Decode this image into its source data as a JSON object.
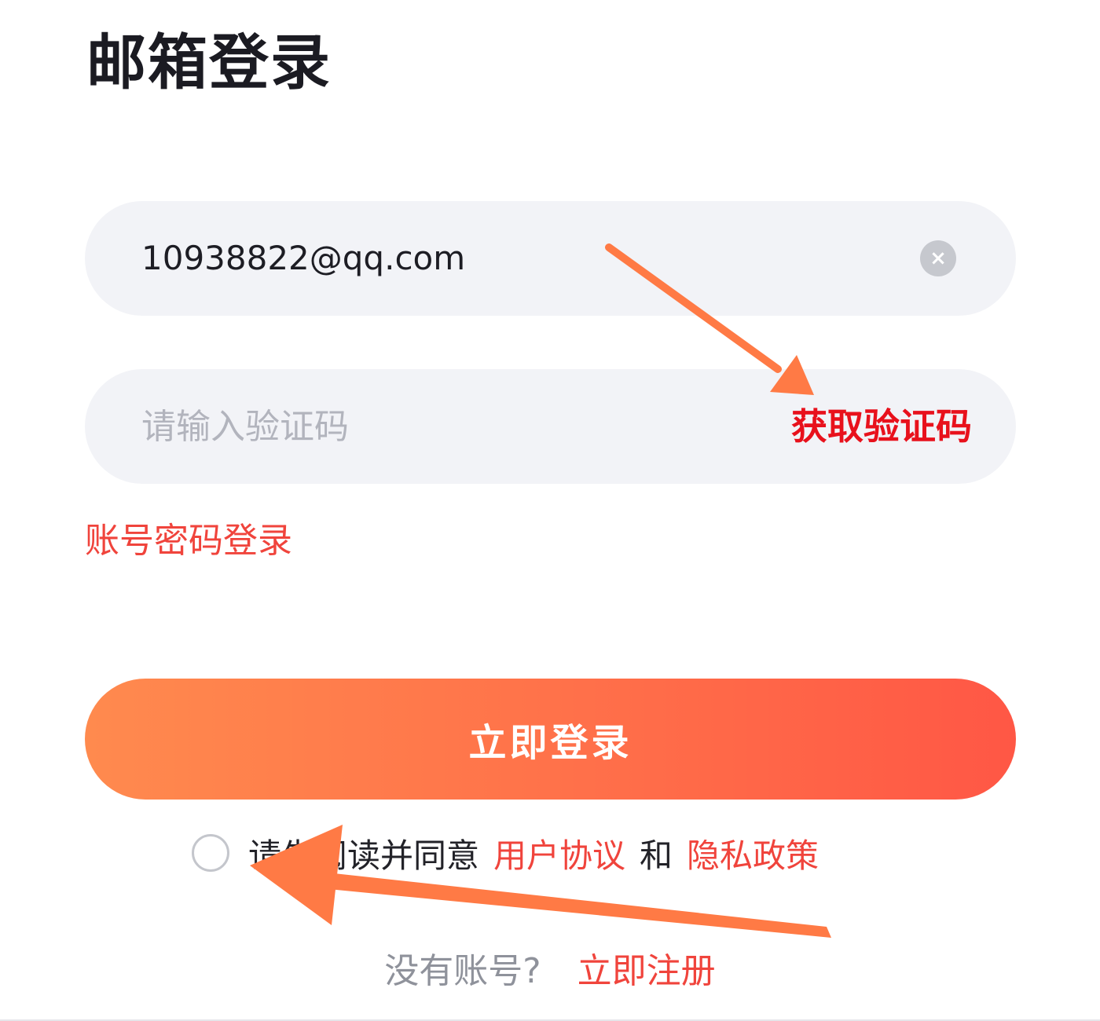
{
  "page": {
    "title": "邮箱登录"
  },
  "email_field": {
    "value": "10938822@qq.com",
    "clear_icon": "close-circle-icon",
    "clear_glyph": "×"
  },
  "code_field": {
    "placeholder": "请输入验证码",
    "value": "",
    "get_code_label": "获取验证码"
  },
  "switch_login": {
    "label": "账号密码登录"
  },
  "login_button": {
    "label": "立即登录"
  },
  "agreement": {
    "checked": false,
    "prefix": "请先阅读并同意",
    "user_agreement": "用户协议",
    "conjunction": "和",
    "privacy_policy": "隐私政策"
  },
  "register": {
    "prompt": "没有账号?",
    "link": "立即注册"
  },
  "colors": {
    "accent_red": "#e8111c",
    "link_red": "#f0443c",
    "button_gradient_start": "#ff8a4e",
    "button_gradient_end": "#ff5745",
    "field_bg": "#f2f3f7",
    "annotation_arrow": "#ff7a45"
  }
}
